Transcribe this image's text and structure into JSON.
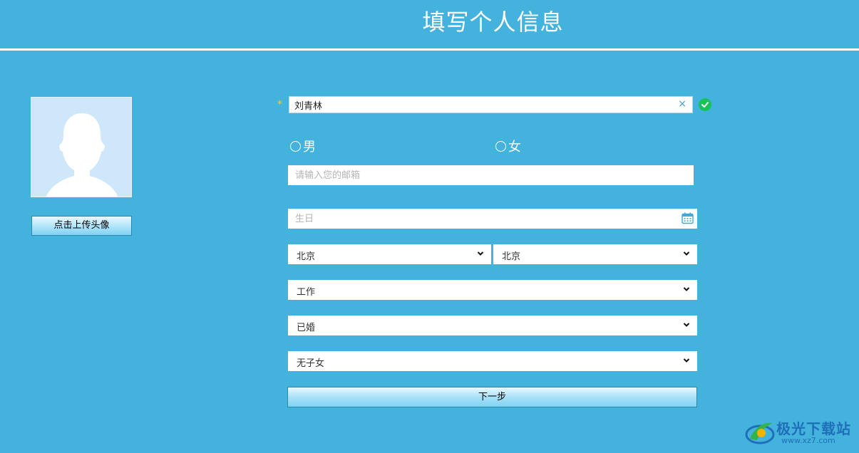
{
  "page": {
    "title": "填写个人信息"
  },
  "avatar": {
    "upload_label": "点击上传头像"
  },
  "form": {
    "required_mark": "*",
    "name_value": "刘青林",
    "clear_symbol": "×",
    "gender": {
      "male": "男",
      "female": "女"
    },
    "email_placeholder": "请输入您的邮箱",
    "birthday_placeholder": "生日",
    "province": "北京",
    "city": "北京",
    "occupation": "工作",
    "marital_status": "已婚",
    "children": "无子女",
    "next_label": "下一步"
  },
  "watermark": {
    "name": "极光下载站",
    "url": "www.xz7.com"
  },
  "colors": {
    "background": "#43b3de",
    "valid_check": "#19c35a",
    "required_star": "#f0d03c",
    "button_border": "#2c86ad"
  },
  "icons": [
    "user-silhouette-icon",
    "clear-icon",
    "check-circle-icon",
    "calendar-icon",
    "chevron-down-icon",
    "watermark-logo-icon"
  ]
}
